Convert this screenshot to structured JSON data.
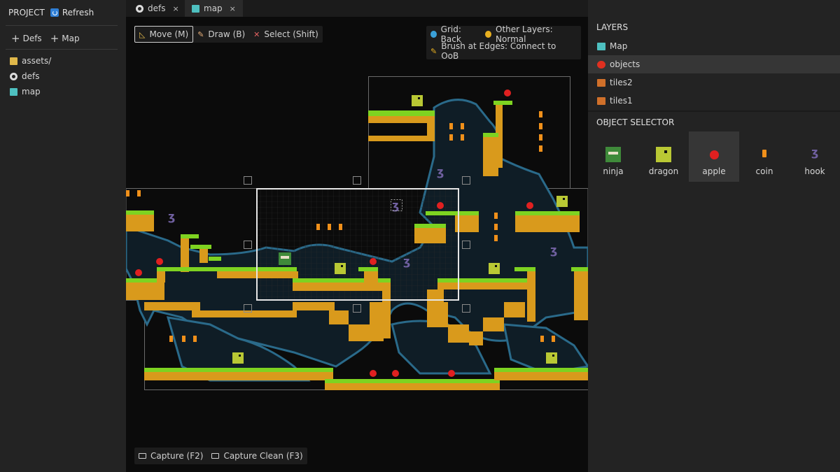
{
  "project": {
    "title": "PROJECT",
    "refresh_label": "Refresh"
  },
  "sidebar": {
    "add_defs_label": "Defs",
    "add_map_label": "Map",
    "items": [
      {
        "label": "assets/",
        "icon": "folder-icon"
      },
      {
        "label": "defs",
        "icon": "gear-icon"
      },
      {
        "label": "map",
        "icon": "map-icon"
      }
    ]
  },
  "tabs": [
    {
      "label": "defs",
      "icon": "gear-icon",
      "close": "×"
    },
    {
      "label": "map",
      "icon": "map-icon",
      "close": "×"
    }
  ],
  "toolbar": {
    "move_label": "Move (M)",
    "draw_label": "Draw (B)",
    "select_label": "Select (Shift)"
  },
  "options": {
    "grid_label": "Grid: Back",
    "layers_label": "Other Layers: Normal",
    "brush_label": "Brush at Edges: Connect to OoB"
  },
  "capture": {
    "capture_label": "Capture (F2)",
    "capture_clean_label": "Capture Clean (F3)"
  },
  "layers": {
    "title": "LAYERS",
    "items": [
      {
        "label": "Map",
        "icon": "map-icon"
      },
      {
        "label": "objects",
        "icon": "apple-icon",
        "selected": true
      },
      {
        "label": "tiles2",
        "icon": "tiles-icon"
      },
      {
        "label": "tiles1",
        "icon": "tiles-icon"
      }
    ]
  },
  "object_selector": {
    "title": "OBJECT SELECTOR",
    "items": [
      {
        "label": "ninja",
        "icon": "ninja-icon"
      },
      {
        "label": "dragon",
        "icon": "dragon-icon"
      },
      {
        "label": "apple",
        "icon": "apple-icon",
        "selected": true
      },
      {
        "label": "coin",
        "icon": "coin-icon"
      },
      {
        "label": "hook",
        "icon": "hook-icon"
      }
    ]
  },
  "colors": {
    "panel_bg": "#232323",
    "canvas_bg": "#0b0b0b",
    "grass": "#7ed321",
    "dirt": "#e0a020",
    "cave": "#0f2a3a",
    "cave_edge": "#2a6a8a",
    "apple": "#e02020",
    "coin": "#f0901a",
    "accent": "#2f7fd6"
  }
}
